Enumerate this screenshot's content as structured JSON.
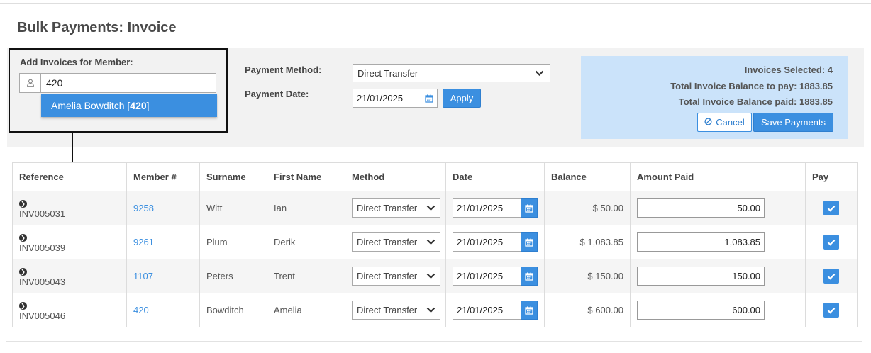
{
  "page": {
    "title": "Bulk Payments: Invoice"
  },
  "member_search": {
    "label": "Add Invoices for Member:",
    "value": "420",
    "suggestion_name": "Amelia Bowditch [",
    "suggestion_id": "420",
    "suggestion_close": "]"
  },
  "payment": {
    "method_label": "Payment Method:",
    "method_value": "Direct Transfer",
    "date_label": "Payment Date:",
    "date_value": "21/01/2025",
    "apply_label": "Apply"
  },
  "summary": {
    "invoices_selected": "Invoices Selected: 4",
    "balance_to_pay": "Total Invoice Balance to pay: 1883.85",
    "balance_paid": "Total Invoice Balance paid: 1883.85",
    "cancel_label": "Cancel",
    "save_label": "Save Payments"
  },
  "table": {
    "headers": [
      "Reference",
      "Member #",
      "Surname",
      "First Name",
      "Method",
      "Date",
      "Balance",
      "Amount Paid",
      "Pay"
    ],
    "rows": [
      {
        "reference": "INV005031",
        "member": "9258",
        "surname": "Witt",
        "first_name": "Ian",
        "method": "Direct Transfer",
        "date": "21/01/2025",
        "balance": "$ 50.00",
        "amount_paid": "50.00",
        "pay": true
      },
      {
        "reference": "INV005039",
        "member": "9261",
        "surname": "Plum",
        "first_name": "Derik",
        "method": "Direct Transfer",
        "date": "21/01/2025",
        "balance": "$ 1,083.85",
        "amount_paid": "1,083.85",
        "pay": true
      },
      {
        "reference": "INV005043",
        "member": "1107",
        "surname": "Peters",
        "first_name": "Trent",
        "method": "Direct Transfer",
        "date": "21/01/2025",
        "balance": "$ 150.00",
        "amount_paid": "150.00",
        "pay": true
      },
      {
        "reference": "INV005046",
        "member": "420",
        "surname": "Bowditch",
        "first_name": "Amelia",
        "method": "Direct Transfer",
        "date": "21/01/2025",
        "balance": "$ 600.00",
        "amount_paid": "600.00",
        "pay": true
      }
    ]
  },
  "colors": {
    "accent": "#3b8fe0",
    "summary_bg": "#cbe3fa",
    "panel_bg": "#f2f2f2"
  },
  "icons": [
    "user-icon",
    "chevron-down-icon",
    "calendar-icon",
    "ban-icon",
    "chevron-right-circle-icon",
    "checkmark-icon"
  ]
}
